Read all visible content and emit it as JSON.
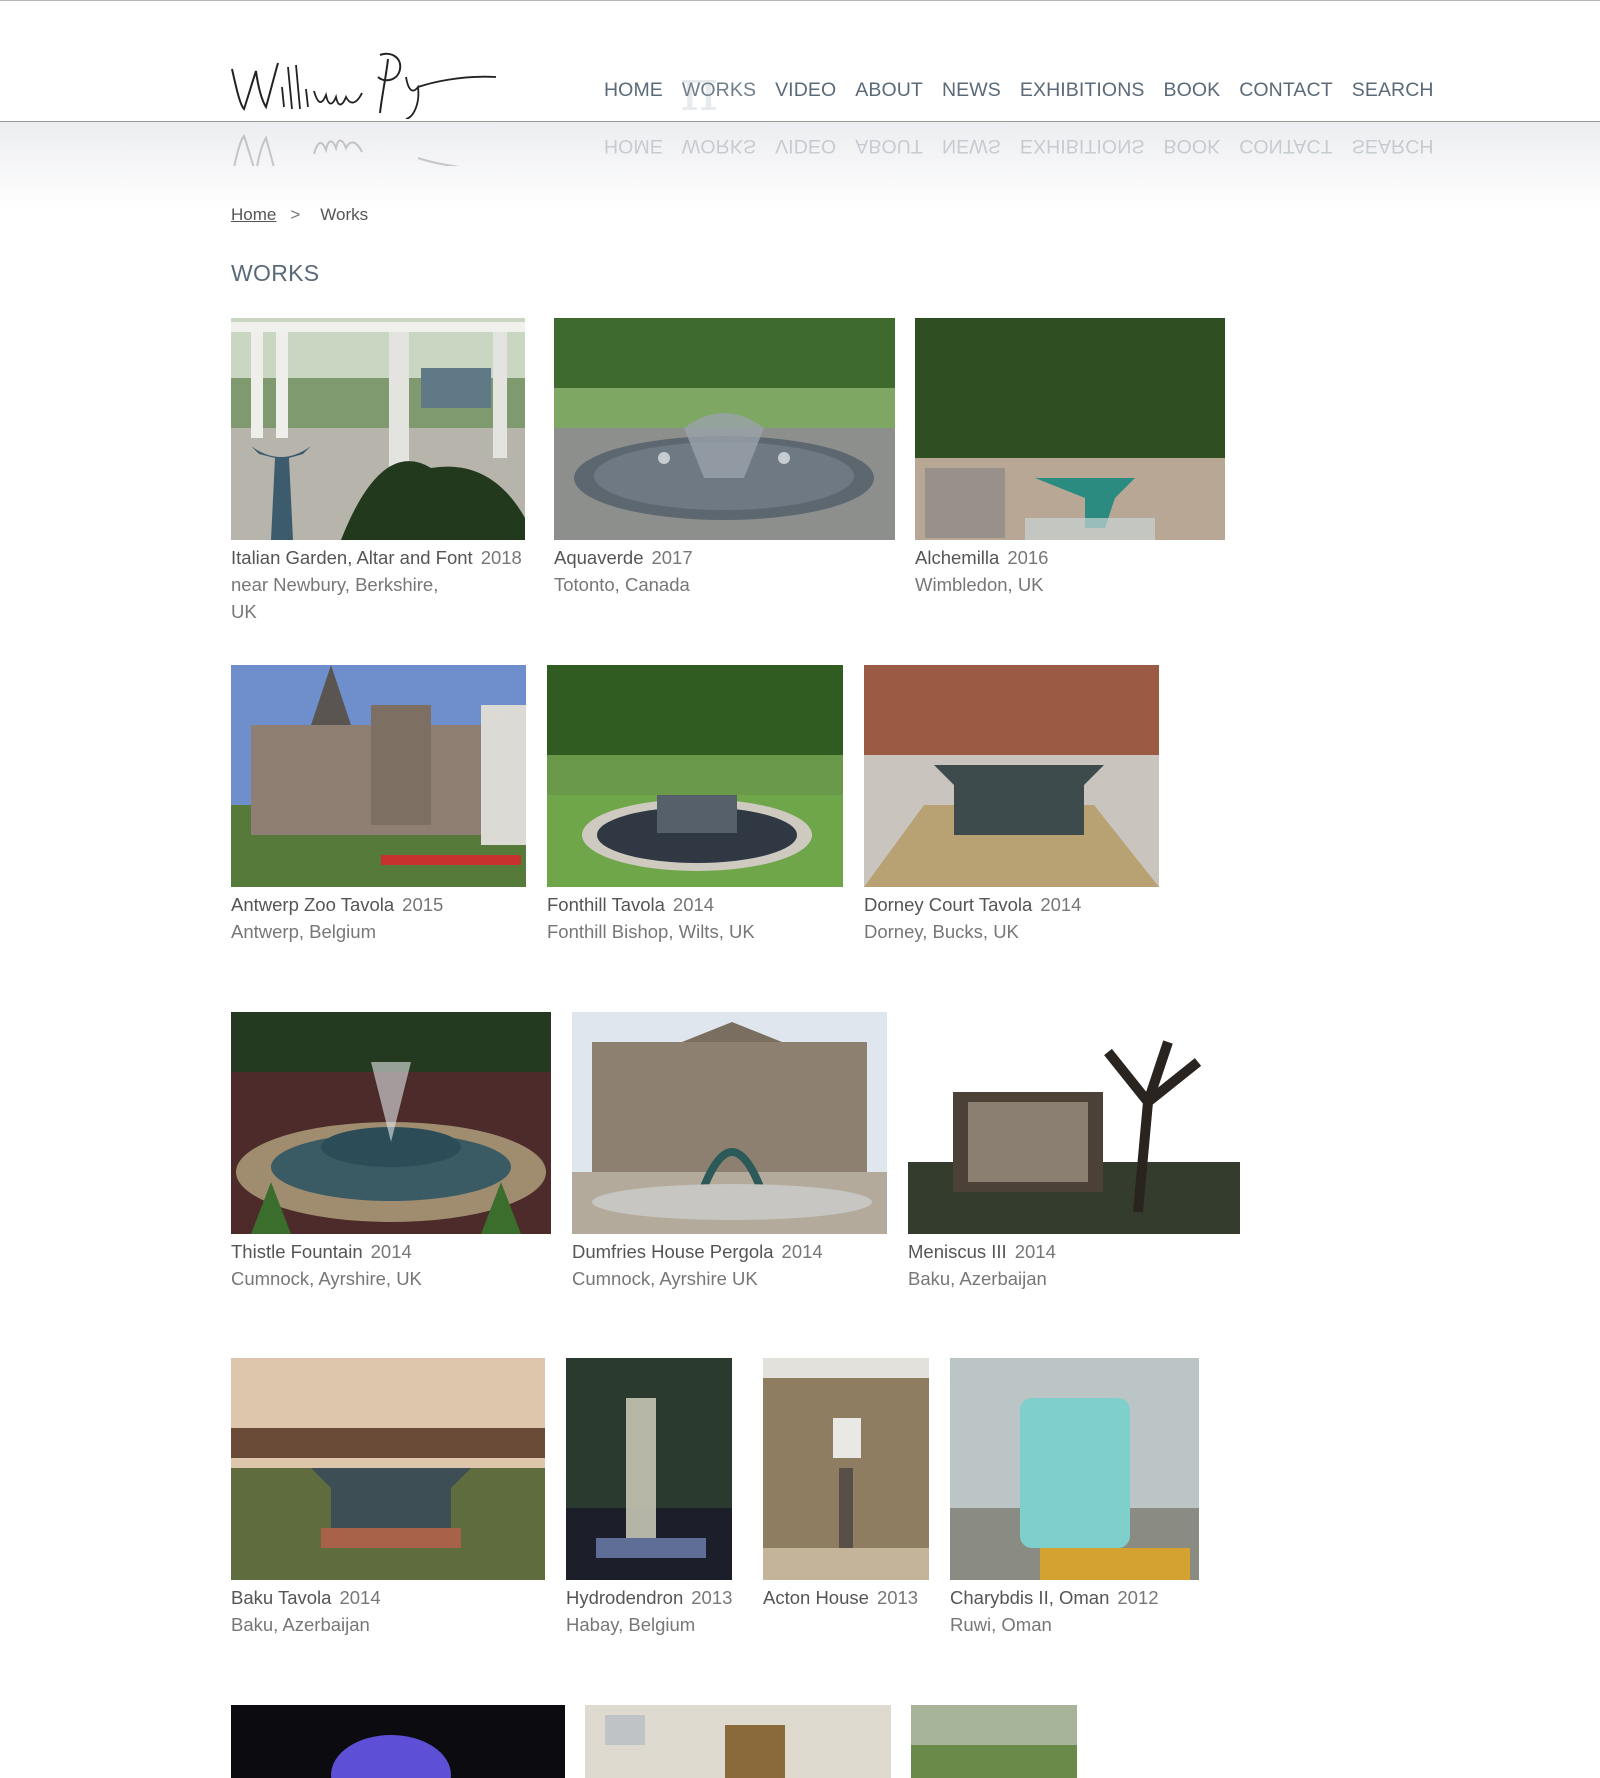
{
  "header": {
    "logo_alt": "William Pye signature",
    "nav": [
      "HOME",
      "WORKS",
      "VIDEO",
      "ABOUT",
      "NEWS",
      "EXHIBITIONS",
      "BOOK",
      "CONTACT",
      "SEARCH"
    ],
    "active_nav": "WORKS"
  },
  "breadcrumb": {
    "home": "Home",
    "separator": ">",
    "current": "Works"
  },
  "page_title": "WORKS",
  "works": [
    {
      "name": "Italian Garden, Altar and Font",
      "year": "2018",
      "location_line1": "near Newbury, Berkshire,",
      "location_line2": "UK"
    },
    {
      "name": "Aquaverde",
      "year": "2017",
      "location_line1": "Totonto, Canada"
    },
    {
      "name": "Alchemilla",
      "year": "2016",
      "location_line1": "Wimbledon, UK"
    },
    {
      "name": "Antwerp Zoo Tavola",
      "year": "2015",
      "location_line1": "Antwerp, Belgium"
    },
    {
      "name": "Fonthill Tavola",
      "year": "2014",
      "location_line1": "Fonthill Bishop, Wilts, UK"
    },
    {
      "name": "Dorney Court Tavola",
      "year": "2014",
      "location_line1": "Dorney, Bucks, UK"
    },
    {
      "name": "Thistle Fountain",
      "year": "2014",
      "location_line1": "Cumnock, Ayrshire, UK"
    },
    {
      "name": "Dumfries House Pergola",
      "year": "2014",
      "location_line1": "Cumnock, Ayrshire UK"
    },
    {
      "name": "Meniscus III",
      "year": "2014",
      "location_line1": "Baku, Azerbaijan"
    },
    {
      "name": "Baku Tavola",
      "year": "2014",
      "location_line1": "Baku, Azerbaijan"
    },
    {
      "name": "Hydrodendron",
      "year": "2013",
      "location_line1": "Habay, Belgium"
    },
    {
      "name": "Acton House",
      "year": "2013",
      "location_line1": ""
    },
    {
      "name": "Charybdis II, Oman",
      "year": "2012",
      "location_line1": "Ruwi, Oman"
    }
  ]
}
